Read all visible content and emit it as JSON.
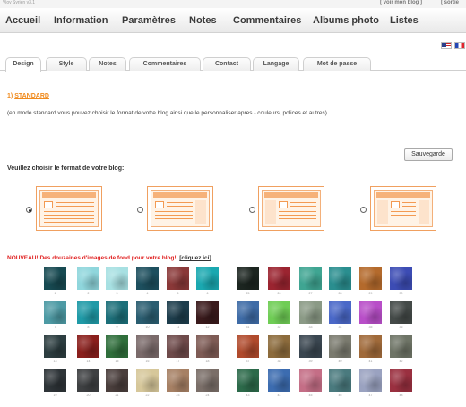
{
  "top": {
    "app_name": "Vioy Syrien v3.1",
    "links": [
      "[ voir mon blog ]",
      "[ sortie"
    ]
  },
  "nav": {
    "items": [
      "Accueil",
      "Information",
      "Paramètres",
      "Notes",
      "Commentaires",
      "Albums photo",
      "Listes"
    ]
  },
  "languages": [
    {
      "name": "english-flag-icon"
    },
    {
      "name": "french-flag-icon"
    }
  ],
  "tabs": {
    "active": "Design",
    "items": [
      "Design",
      "Style",
      "Notes",
      "Commentaires",
      "Contact",
      "Langage",
      "Mot de passe"
    ]
  },
  "section": {
    "number": "1)",
    "title": "STANDARD",
    "description": "(en mode standard vous pouvez choisir le format de votre blog ainsi que le personnaliser apres - couleurs, polices et autres)"
  },
  "save_label": "Sauvegarde",
  "format": {
    "label": "Veuillez choisir le format de votre blog:",
    "options": [
      {
        "name": "layout-option-1",
        "selected": true
      },
      {
        "name": "layout-option-2",
        "selected": false
      },
      {
        "name": "layout-option-3",
        "selected": false
      },
      {
        "name": "layout-option-4",
        "selected": false
      }
    ]
  },
  "backgrounds": {
    "announcement": "NOUVEAU! Des douzaines d'images de fond pour votre blog!.",
    "link": "[cliquez ici]",
    "rows": [
      {
        "colors": [
          "#174a52",
          "#8fd6dc",
          "#a7e0e2",
          "#1d4f5e",
          "#8a3838",
          "#1aa8b0",
          "#1c2520",
          "#9b2430",
          "#3fa592",
          "#2a8e8f",
          "#b46a2c",
          "#3c4cb4"
        ],
        "numbers": [
          "1",
          "2",
          "3",
          "4",
          "5",
          "6",
          "25",
          "26",
          "27",
          "28",
          "29",
          "30"
        ]
      },
      {
        "colors": [
          "#4d9aa4",
          "#1f9aa7",
          "#1c6f79",
          "#2a5d70",
          "#1d3d4c",
          "#3a1a1c",
          "#3e6ba6",
          "#6fcd55",
          "#8b9a86",
          "#4a68c8",
          "#b84ec8",
          "#444a48"
        ],
        "numbers": [
          "7",
          "8",
          "9",
          "10",
          "11",
          "12",
          "31",
          "32",
          "33",
          "34",
          "35",
          "36"
        ]
      },
      {
        "colors": [
          "#2c3d40",
          "#8a1f1c",
          "#2f6e3b",
          "#7a6a6a",
          "#6e4a4a",
          "#7e5b55",
          "#b04a2c",
          "#8c6b3c",
          "#3a4650",
          "#7a7a6e",
          "#a06a3a",
          "#6e7466"
        ],
        "numbers": [
          "13",
          "14",
          "15",
          "16",
          "17",
          "18",
          "37",
          "38",
          "39",
          "40",
          "41",
          "42"
        ]
      },
      {
        "colors": [
          "#2e3438",
          "#3e4042",
          "#4a3e3c",
          "#d6c79a",
          "#a68064",
          "#7a6e68",
          "#2c6a4a",
          "#3c6cb0",
          "#c46e86",
          "#4a7a7e",
          "#9aa2c0",
          "#9a3040"
        ],
        "numbers": [
          "19",
          "20",
          "21",
          "22",
          "23",
          "24",
          "43",
          "44",
          "45",
          "46",
          "47",
          "48"
        ]
      }
    ]
  }
}
